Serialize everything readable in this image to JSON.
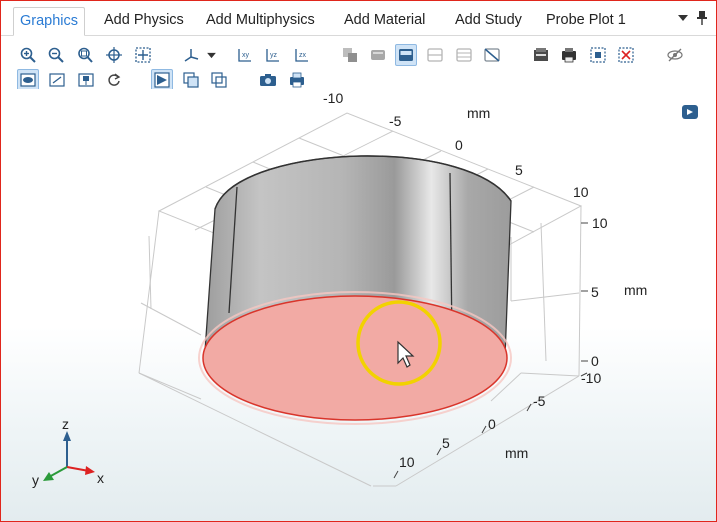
{
  "tabs": [
    {
      "label": "Graphics",
      "active": true
    },
    {
      "label": "Add Physics",
      "active": false
    },
    {
      "label": "Add Multiphysics",
      "active": false
    },
    {
      "label": "Add Material",
      "active": false
    },
    {
      "label": "Add Study",
      "active": false
    },
    {
      "label": "Probe Plot 1",
      "active": false
    }
  ],
  "tab_controls": {
    "menu_glyph": "▼",
    "pin_glyph": "📌"
  },
  "toolbar_row1": [
    "zoom-in-icon",
    "zoom-out-icon",
    "zoom-box-icon",
    "zoom-selected-icon",
    "zoom-extents-icon",
    "axis-orientation-icon",
    "dropdown-arrow-icon",
    "xy-view-icon",
    "yz-view-icon",
    "zx-view-icon",
    "transparency-icon",
    "wireframe-icon",
    "render-mode-icon",
    "clip-plane-icon",
    "clip-box-icon",
    "no-clip-icon",
    "grid-icon",
    "print-icon",
    "select-all-icon",
    "clear-selection-icon",
    "hide-icon"
  ],
  "toolbar_row2": [
    "show-geometry-icon",
    "show-labels-icon",
    "show-edges-icon",
    "reset-icon",
    "select-domain-icon",
    "select-boundary-icon",
    "select-edge-icon",
    "camera-icon",
    "print-image-icon"
  ],
  "axes": {
    "y_top_label": "-10",
    "y_back_ticks": [
      "-5",
      "0",
      "5",
      "10"
    ],
    "y_back_unit": "mm",
    "z_ticks": [
      "10",
      "5",
      "0"
    ],
    "z_unit": "mm",
    "y_right_start": "-10",
    "x_front_ticks": [
      "-5",
      "0",
      "5",
      "10"
    ],
    "x_front_unit": "mm"
  },
  "triad": {
    "z": "z",
    "y": "y",
    "x": "x"
  },
  "colors": {
    "accent": "#2a7bd4",
    "selected_face": "#f2aaa4",
    "highlight_ring": "#f2d200",
    "window_border": "#e0261c"
  }
}
